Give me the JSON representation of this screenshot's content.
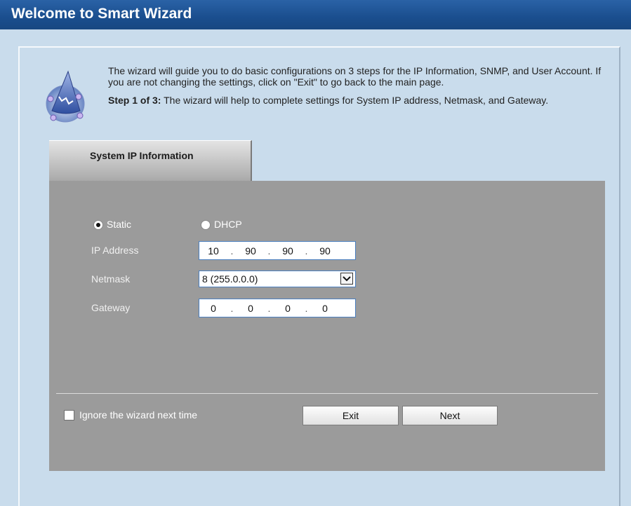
{
  "window": {
    "title": "Welcome to Smart Wizard"
  },
  "intro": {
    "text": "The wizard will guide you to do basic configurations on 3 steps for the IP Information, SNMP, and User Account. If you are not changing the settings, click on \"Exit\" to go back to the main page.",
    "step_label": "Step 1 of 3:",
    "step_text": " The wizard will help to complete settings for System IP address, Netmask, and Gateway."
  },
  "tab": {
    "label": "System IP Information"
  },
  "form": {
    "mode_static": {
      "label": "Static",
      "selected": true
    },
    "mode_dhcp": {
      "label": "DHCP",
      "selected": false
    },
    "ip_label": "IP Address",
    "ip_octets": [
      "10",
      "90",
      "90",
      "90"
    ],
    "netmask_label": "Netmask",
    "netmask_value": "8 (255.0.0.0)",
    "gateway_label": "Gateway",
    "gateway_octets": [
      "0",
      "0",
      "0",
      "0"
    ],
    "dot": "."
  },
  "footer": {
    "ignore_label": "Ignore the wizard next time",
    "ignore_checked": false,
    "exit_label": "Exit",
    "next_label": "Next"
  },
  "icons": {
    "wizard": "wizard-hat-icon",
    "dropdown": "chevron-down-icon"
  }
}
